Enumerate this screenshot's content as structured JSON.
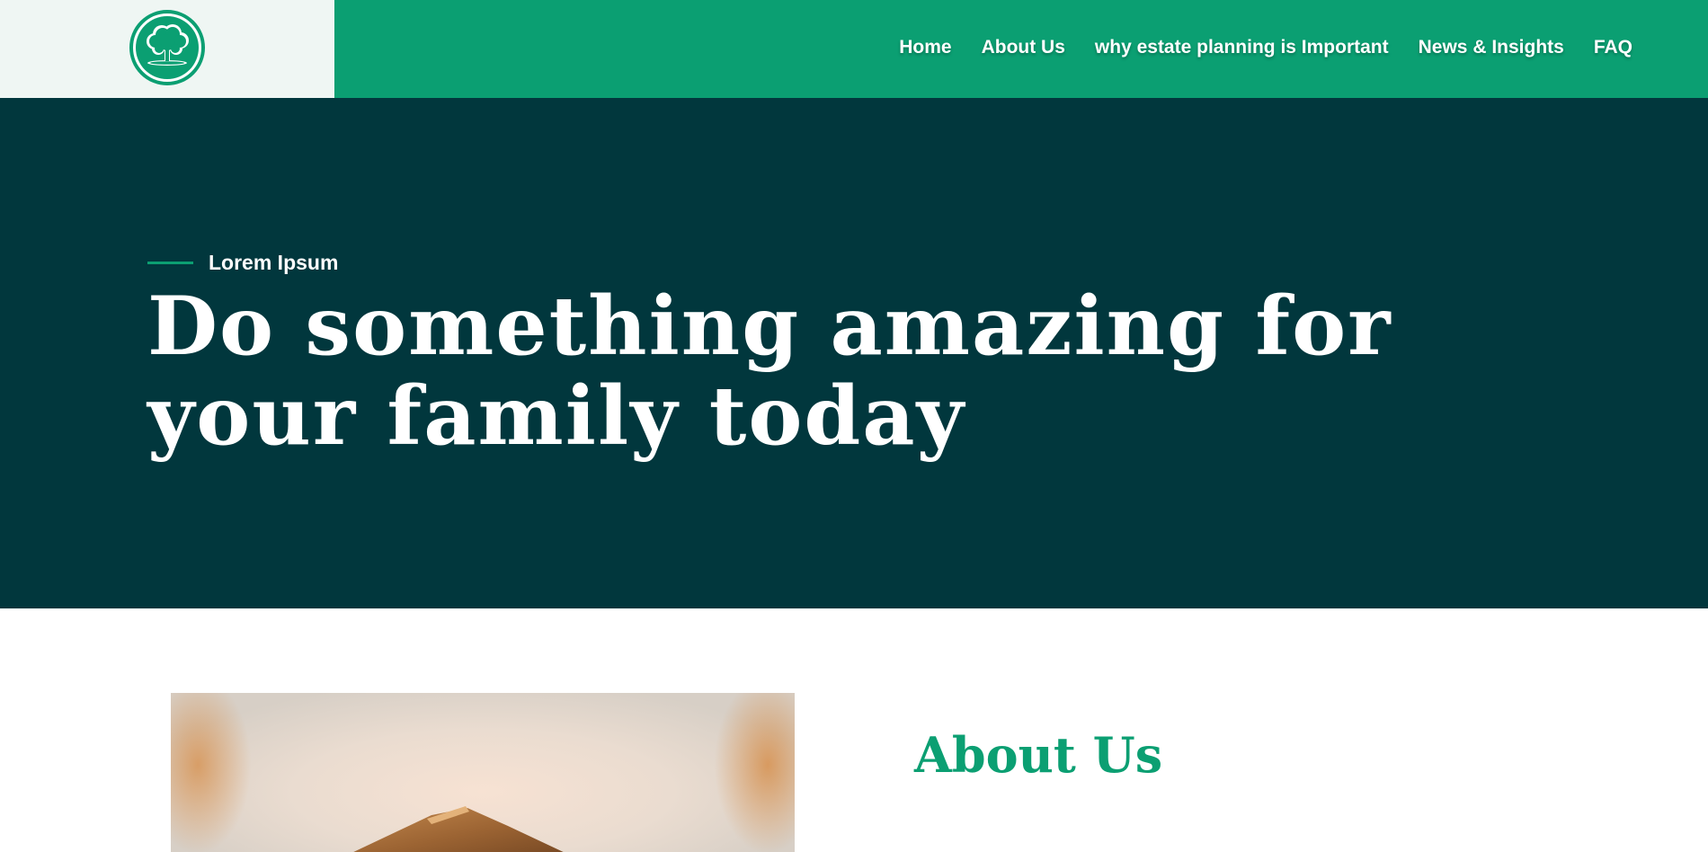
{
  "header": {
    "logo_icon": "tree-icon",
    "nav": [
      {
        "label": "Home"
      },
      {
        "label": "About Us"
      },
      {
        "label": "why estate planning is Important"
      },
      {
        "label": "News & Insights"
      },
      {
        "label": "FAQ"
      }
    ]
  },
  "hero": {
    "eyebrow": "Lorem Ipsum",
    "title": "Do something amazing for your family today"
  },
  "about": {
    "title": "About Us",
    "image_icon": "house-model-photo"
  },
  "colors": {
    "brand_green": "#0b9f72",
    "hero_bg": "#01373d",
    "logo_panel_bg": "#eff6f3",
    "text_light": "#ffffff"
  }
}
